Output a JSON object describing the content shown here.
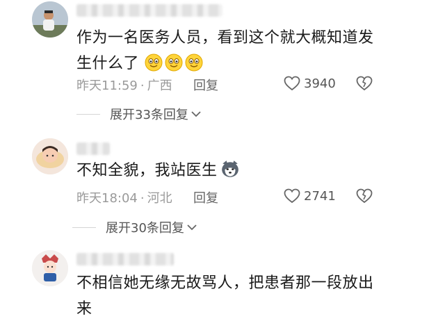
{
  "comments": [
    {
      "avatar_icon": "man-photo-avatar",
      "text_lines": [
        "作为一名医务人员，看到这个就大概知道发",
        "生什么了"
      ],
      "emojis": [
        "grinning-emoji",
        "grinning-emoji",
        "grinning-emoji"
      ],
      "time": "昨天11:59",
      "location": "广西",
      "reply_label": "回复",
      "likes": "3940",
      "expand_label": "展开33条回复"
    },
    {
      "avatar_icon": "child-photo-avatar",
      "text_lines": [
        "不知全貌，我站医生"
      ],
      "emojis": [
        "husky-dog-emoji"
      ],
      "time": "昨天18:04",
      "location": "河北",
      "reply_label": "回复",
      "likes": "2741",
      "expand_label": "展开30条回复"
    },
    {
      "avatar_icon": "cartoon-avatar",
      "text_lines": [
        "不相信她无缘无故骂人，把患者那一段放出",
        "来"
      ]
    }
  ],
  "separator": "·",
  "colors": {
    "meta": "#9a9a9a",
    "text": "#1a1a1a",
    "icon": "#666666"
  }
}
